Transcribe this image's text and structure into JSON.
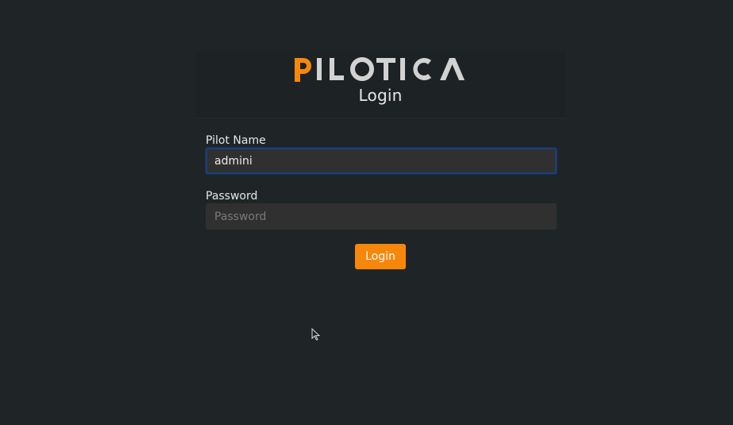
{
  "header": {
    "logo": {
      "text": "PILOTICA",
      "icon": "pilotica-logo",
      "accent_color": "#f7870a",
      "text_color": "#d2d2d2"
    },
    "title": "Login"
  },
  "form": {
    "pilot_name": {
      "label": "Pilot Name",
      "value": "admini",
      "focused": true
    },
    "password": {
      "label": "Password",
      "placeholder": "Password",
      "value": ""
    },
    "submit": {
      "label": "Login",
      "color": "#f7870a"
    }
  },
  "colors": {
    "background": "#1f2527",
    "input_background": "#303030",
    "focus_border": "#1f3f78"
  },
  "cursor": {
    "icon": "mouse-pointer-icon"
  }
}
